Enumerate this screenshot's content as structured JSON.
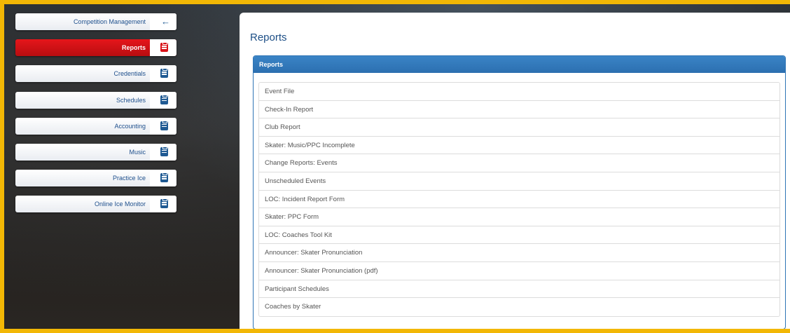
{
  "sidebar": {
    "items": [
      {
        "label": "Competition Management"
      },
      {
        "label": "Reports"
      },
      {
        "label": "Credentials"
      },
      {
        "label": "Schedules"
      },
      {
        "label": "Accounting"
      },
      {
        "label": "Music"
      },
      {
        "label": "Practice Ice"
      },
      {
        "label": "Online Ice Monitor"
      }
    ]
  },
  "main": {
    "title": "Reports",
    "panel_header": "Reports",
    "reports": [
      "Event File",
      "Check-In Report",
      "Club Report",
      "Skater: Music/PPC Incomplete",
      "Change Reports: Events",
      "Unscheduled Events",
      "LOC: Incident Report Form",
      "Skater: PPC Form",
      "LOC: Coaches Tool Kit",
      "Announcer: Skater Pronunciation",
      "Announcer: Skater Pronunciation (pdf)",
      "Participant Schedules",
      "Coaches by Skater"
    ]
  },
  "colors": {
    "frame": "#f2b705",
    "accent_blue": "#1f5a93",
    "active_red": "#d9141a",
    "panel_header": "#2e74b5"
  }
}
